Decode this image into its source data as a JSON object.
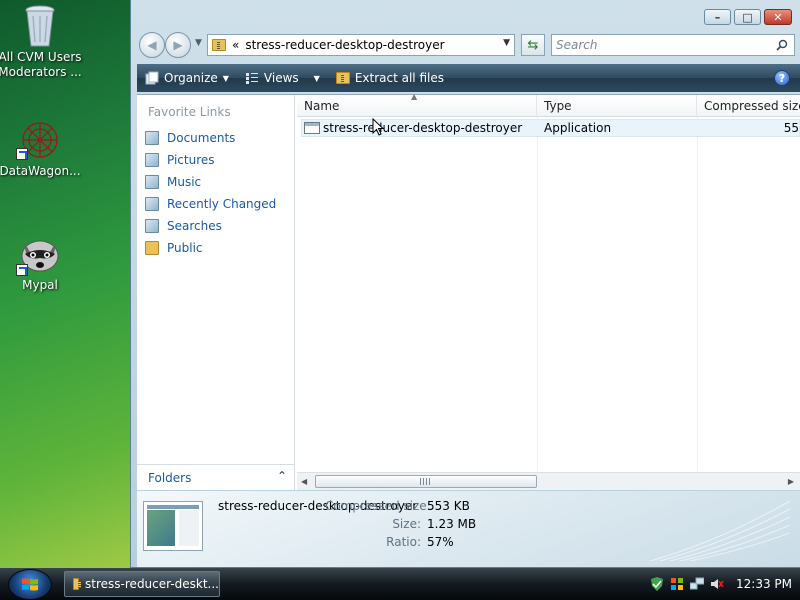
{
  "desktop": {
    "icons": [
      {
        "label": "All CVM Users Moderators ...",
        "icon": "recycle-bin-icon"
      },
      {
        "label": "DataWagon...",
        "icon": "datawagon-icon"
      },
      {
        "label": "Mypal",
        "icon": "raccoon-icon"
      }
    ]
  },
  "window": {
    "controls": {
      "minimize": "–",
      "maximize": "□",
      "close": "✕"
    },
    "address": {
      "prefix": "«",
      "path": "stress-reducer-desktop-destroyer"
    },
    "search": {
      "placeholder": "Search"
    },
    "toolbar": {
      "organize": "Organize",
      "views": "Views",
      "extract": "Extract all files",
      "help": "?"
    },
    "nav_pane": {
      "heading": "Favorite Links",
      "items": [
        {
          "label": "Documents",
          "icon": "documents-icon"
        },
        {
          "label": "Pictures",
          "icon": "pictures-icon"
        },
        {
          "label": "Music",
          "icon": "music-icon"
        },
        {
          "label": "Recently Changed",
          "icon": "recently-changed-icon"
        },
        {
          "label": "Searches",
          "icon": "searches-icon"
        },
        {
          "label": "Public",
          "icon": "public-folder-icon"
        }
      ],
      "folders": "Folders"
    },
    "columns": {
      "name": "Name",
      "type": "Type",
      "compressed": "Compressed size"
    },
    "files": [
      {
        "name": "stress-reducer-desktop-destroyer",
        "type": "Application",
        "compressed": "55"
      }
    ],
    "details": {
      "name": "stress-reducer-desktop-destroyer",
      "compressed_label": "Compressed size:",
      "compressed_value": "553 KB",
      "size_label": "Size:",
      "size_value": "1.23 MB",
      "ratio_label": "Ratio:",
      "ratio_value": "57%"
    }
  },
  "taskbar": {
    "task_label": "stress-reducer-deskt...",
    "clock": "12:33 PM"
  }
}
